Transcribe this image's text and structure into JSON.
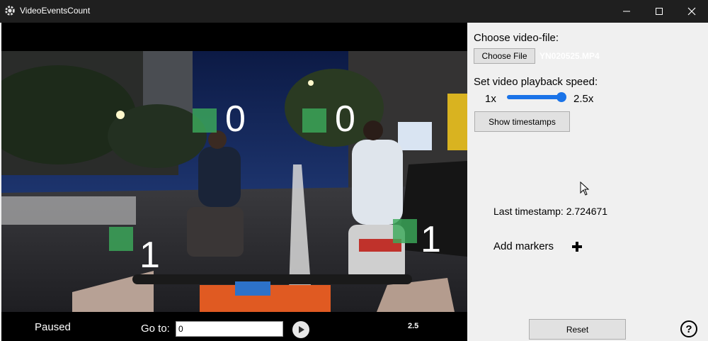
{
  "window": {
    "title": "VideoEventsCount",
    "app_icon": "gear-icon",
    "buttons": [
      "minimize-icon",
      "maximize-icon",
      "close-icon"
    ]
  },
  "video": {
    "markers": [
      {
        "count": "0"
      },
      {
        "count": "0"
      },
      {
        "count": "1"
      },
      {
        "count": "1"
      }
    ],
    "marker_color": "#3caa5a"
  },
  "controls": {
    "status": "Paused",
    "goto_label": "Go to:",
    "goto_value": "0",
    "play_icon": "play-icon",
    "speed_readout": "2.5"
  },
  "panel": {
    "choose_label": "Choose video-file:",
    "choose_button": "Choose File",
    "file_name": "YN020525.MP4",
    "speed_label": "Set video playback speed:",
    "speed_min": "1x",
    "speed_max": "2.5x",
    "speed_level": 1.0,
    "slider_color": "#1a73e8",
    "show_timestamps": "Show timestamps",
    "last_timestamp": "Last timestamp: 2.724671",
    "add_markers": "Add markers",
    "add_icon": "plus-icon",
    "reset": "Reset",
    "help_icon": "question-mark-icon",
    "help_text": "?"
  }
}
